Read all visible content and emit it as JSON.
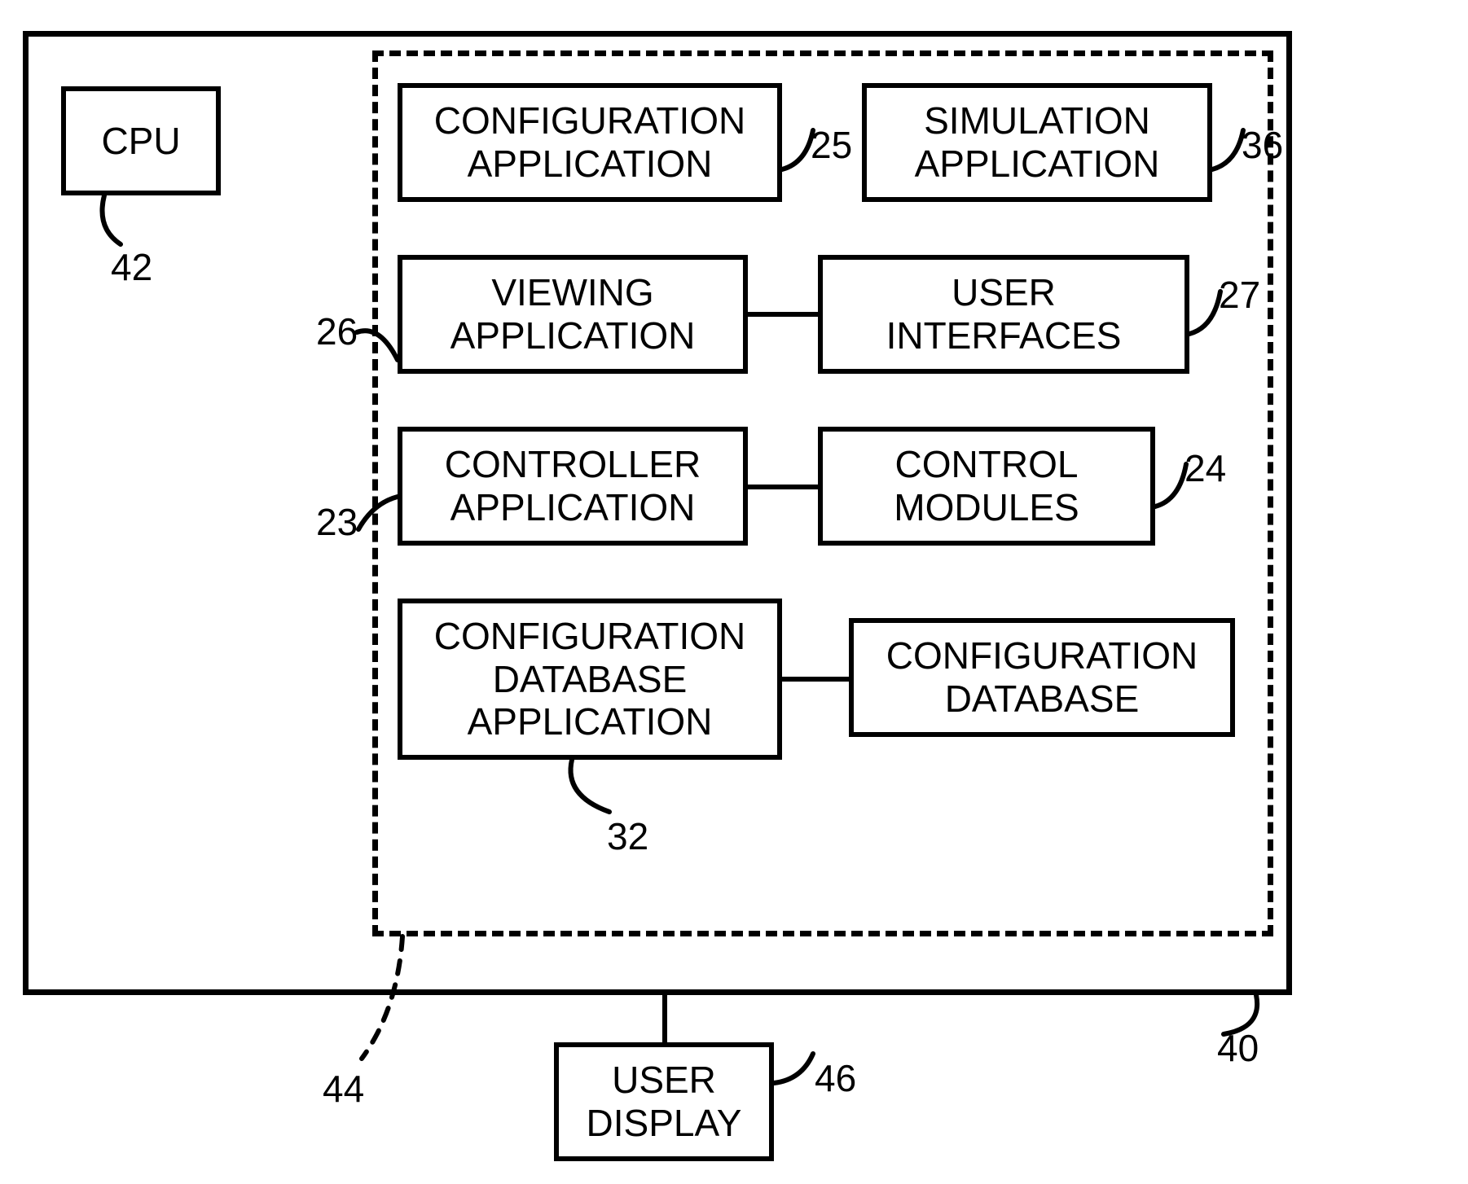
{
  "blocks": {
    "cpu": "CPU",
    "config_app": "CONFIGURATION APPLICATION",
    "sim_app": "SIMULATION APPLICATION",
    "view_app": "VIEWING APPLICATION",
    "user_if": "USER INTERFACES",
    "ctrl_app": "CONTROLLER APPLICATION",
    "ctrl_mod": "CONTROL MODULES",
    "cfg_db_app": "CONFIGURATION DATABASE APPLICATION",
    "cfg_db": "CONFIGURATION DATABASE",
    "user_disp": "USER DISPLAY"
  },
  "refs": {
    "cpu": "42",
    "config_app": "25",
    "sim_app": "36",
    "view_app": "26",
    "user_if": "27",
    "ctrl_app": "23",
    "ctrl_mod": "24",
    "cfg_db_app": "32",
    "outer": "40",
    "dashed": "44",
    "user_disp": "46"
  }
}
